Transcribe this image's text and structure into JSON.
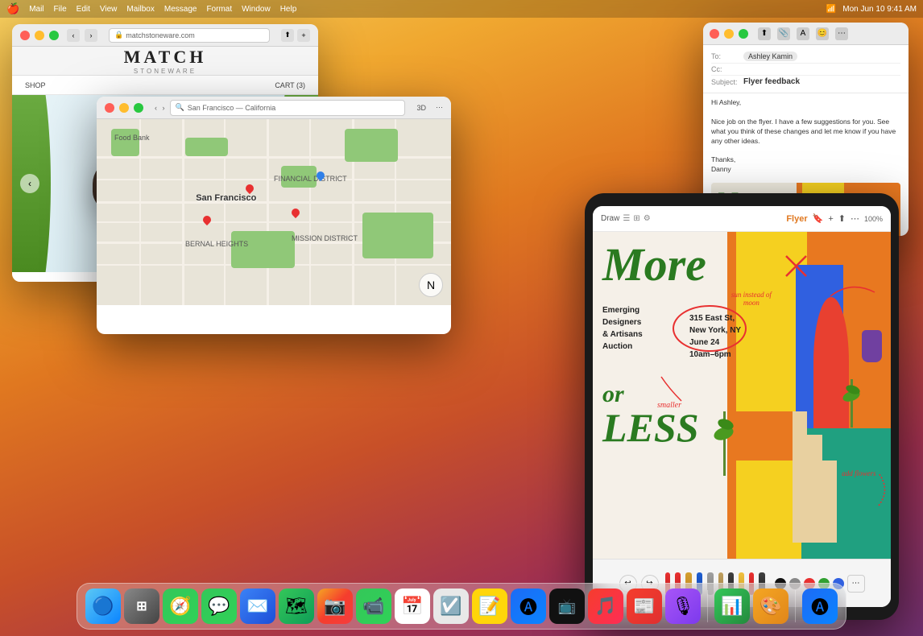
{
  "desktop": {
    "bg_colors": [
      "#f7d060",
      "#f0a830",
      "#e07820",
      "#c85028",
      "#a03050",
      "#703070"
    ]
  },
  "menubar": {
    "apple": "🍎",
    "items": [
      "Mail",
      "File",
      "Edit",
      "View",
      "Mailbox",
      "Message",
      "Format",
      "Window",
      "Help"
    ],
    "right": [
      "Mon Jun 10",
      "9:41 AM"
    ]
  },
  "safari_window": {
    "title": "Match Stoneware",
    "url": "matchstoneware.com",
    "brand": "MATCH",
    "sub_brand": "STONEWARE",
    "nav_items": [
      "SHOP"
    ],
    "cart": "CART (3)"
  },
  "maps_window": {
    "title": "San Francisco — California",
    "location_label": "San Francisco",
    "search_placeholder": "San Francisco — California"
  },
  "mail_window": {
    "to": "Ashley Kamin",
    "subject": "Flyer feedback",
    "body_lines": [
      "Hi Ashley,",
      "",
      "Nice job on the flyer. I have a few suggestions for you. See what you think of these changes and let",
      "me know if you have any other ideas.",
      "",
      "Thanks,",
      "Danny"
    ]
  },
  "ipad": {
    "app_name": "Draw",
    "doc_name": "Flyer"
  },
  "flyer": {
    "more_text": "More",
    "or_text": "or",
    "less_text": "LESS",
    "info_line1": "Emerging",
    "info_line2": "Designers",
    "info_line3": "& Artisans",
    "info_line4": "Auction",
    "address_line1": "315 East St,",
    "address_line2": "New York, NY",
    "date_line": "June 24",
    "time_line": "10am–6pm",
    "annotation_smaller": "smaller",
    "annotation_sun": "sun instead of moon",
    "annotation_add_flowers": "add flowers"
  },
  "dock": {
    "icons": [
      {
        "name": "Finder",
        "emoji": "🔵"
      },
      {
        "name": "Launchpad",
        "emoji": "⊞"
      },
      {
        "name": "Safari",
        "emoji": "🧭"
      },
      {
        "name": "Messages",
        "emoji": "💬"
      },
      {
        "name": "Mail",
        "emoji": "✉️"
      },
      {
        "name": "Maps",
        "emoji": "🗺"
      },
      {
        "name": "Photos",
        "emoji": "📷"
      },
      {
        "name": "FaceTime",
        "emoji": "📹"
      },
      {
        "name": "Calendar",
        "emoji": "📅"
      },
      {
        "name": "Reminders",
        "emoji": "📋"
      },
      {
        "name": "Notes",
        "emoji": "📝"
      },
      {
        "name": "App Store",
        "emoji": "🅐"
      },
      {
        "name": "Apple TV",
        "emoji": "📺"
      },
      {
        "name": "Music",
        "emoji": "🎵"
      },
      {
        "name": "News",
        "emoji": "📰"
      },
      {
        "name": "Podcasts",
        "emoji": "🎙"
      },
      {
        "name": "Numbers",
        "emoji": "📊"
      },
      {
        "name": "Keynote",
        "emoji": "🎨"
      }
    ]
  }
}
